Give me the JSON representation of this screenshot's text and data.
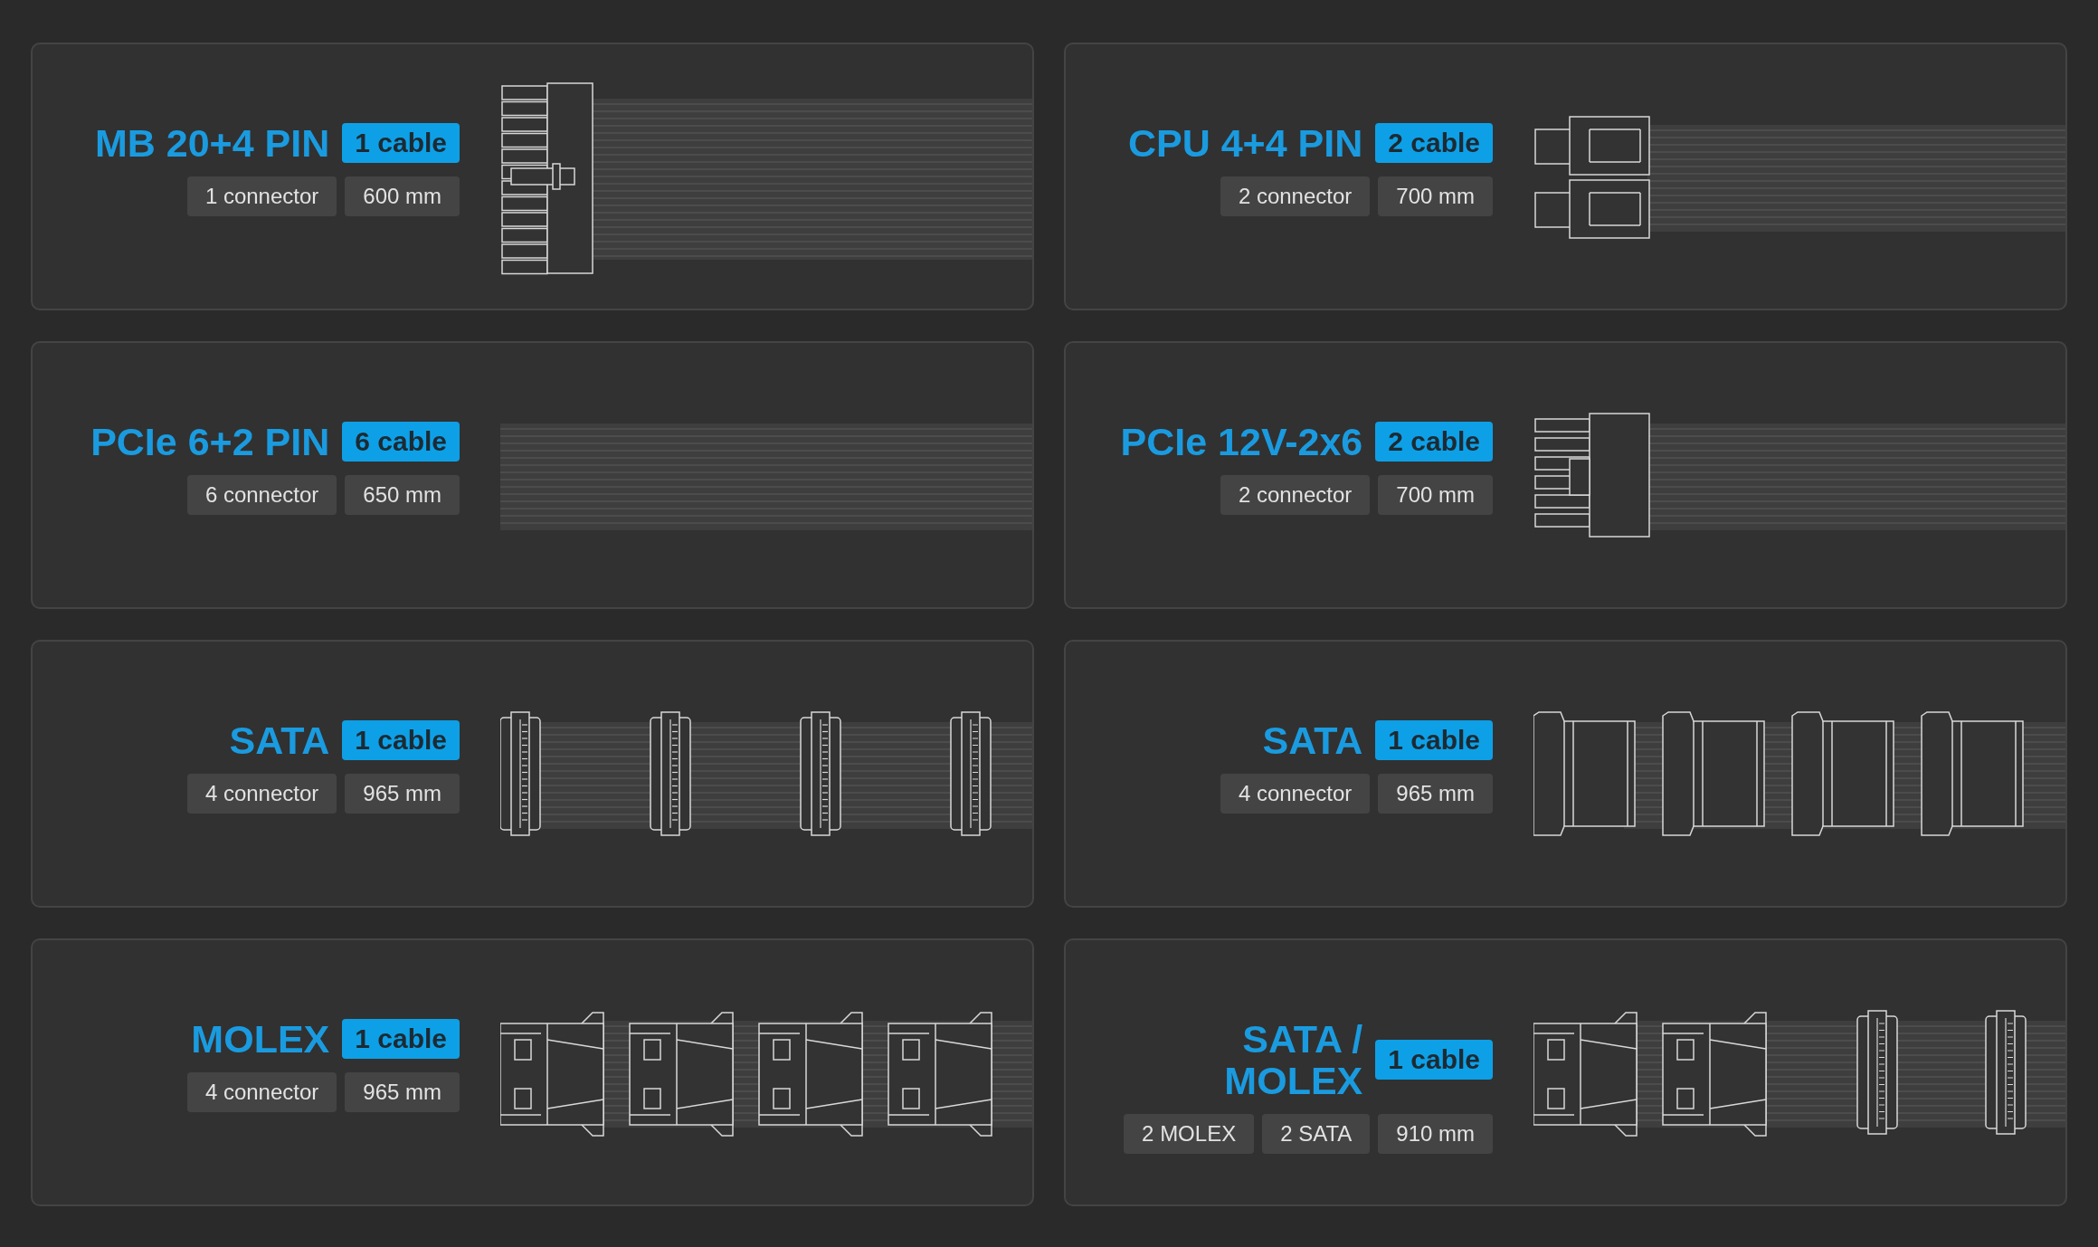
{
  "cards": [
    {
      "title_lines": [
        "MB 20+4 PIN"
      ],
      "cables": "1 cable",
      "tags": [
        "1 connector",
        "600 mm"
      ],
      "kind": "atx24"
    },
    {
      "title_lines": [
        "CPU 4+4 PIN"
      ],
      "cables": "2 cable",
      "tags": [
        "2 connector",
        "700 mm"
      ],
      "kind": "eps"
    },
    {
      "title_lines": [
        "PCIe 6+2 PIN"
      ],
      "cables": "6 cable",
      "tags": [
        "6 connector",
        "650 mm"
      ],
      "kind": "pcie"
    },
    {
      "title_lines": [
        "PCIe 12V-2x6"
      ],
      "cables": "2 cable",
      "tags": [
        "2 connector",
        "700 mm"
      ],
      "kind": "hpwr"
    },
    {
      "title_lines": [
        "SATA"
      ],
      "cables": "1 cable",
      "tags": [
        "4 connector",
        "965 mm"
      ],
      "kind": "sata"
    },
    {
      "title_lines": [
        "SATA"
      ],
      "cables": "1 cable",
      "tags": [
        "4 connector",
        "965 mm"
      ],
      "kind": "sata_side"
    },
    {
      "title_lines": [
        "MOLEX"
      ],
      "cables": "1 cable",
      "tags": [
        "4 connector",
        "965 mm"
      ],
      "kind": "molex"
    },
    {
      "title_lines": [
        "SATA /",
        "MOLEX"
      ],
      "cables": "1 cable",
      "tags": [
        "2 MOLEX",
        "2 SATA",
        "910 mm"
      ],
      "kind": "sata_molex"
    }
  ]
}
